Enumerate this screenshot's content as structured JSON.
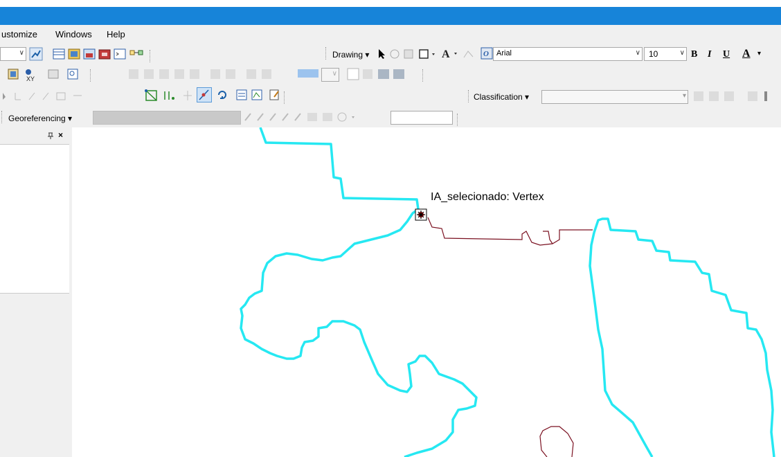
{
  "menu": {
    "items": [
      "ustomize",
      "Windows",
      "Help"
    ]
  },
  "drawing_toolbar": {
    "drawing_label": "Drawing",
    "font_name": "Arial",
    "font_size": "10",
    "bold": "B",
    "italic": "I",
    "underline": "U",
    "font_color": "A"
  },
  "classification_toolbar": {
    "label": "Classification"
  },
  "georef_toolbar": {
    "label": "Georeferencing"
  },
  "side_panel": {
    "pin_icon": "pin-icon",
    "close_label": "×"
  },
  "map": {
    "vertex_label": "IA_selecionado: Vertex",
    "polygon_color": "#26e8f2",
    "selected_color": "#7a1020"
  },
  "colors": {
    "titlebar": "#1784d9",
    "toolbar_bg": "#f0f0f0"
  }
}
